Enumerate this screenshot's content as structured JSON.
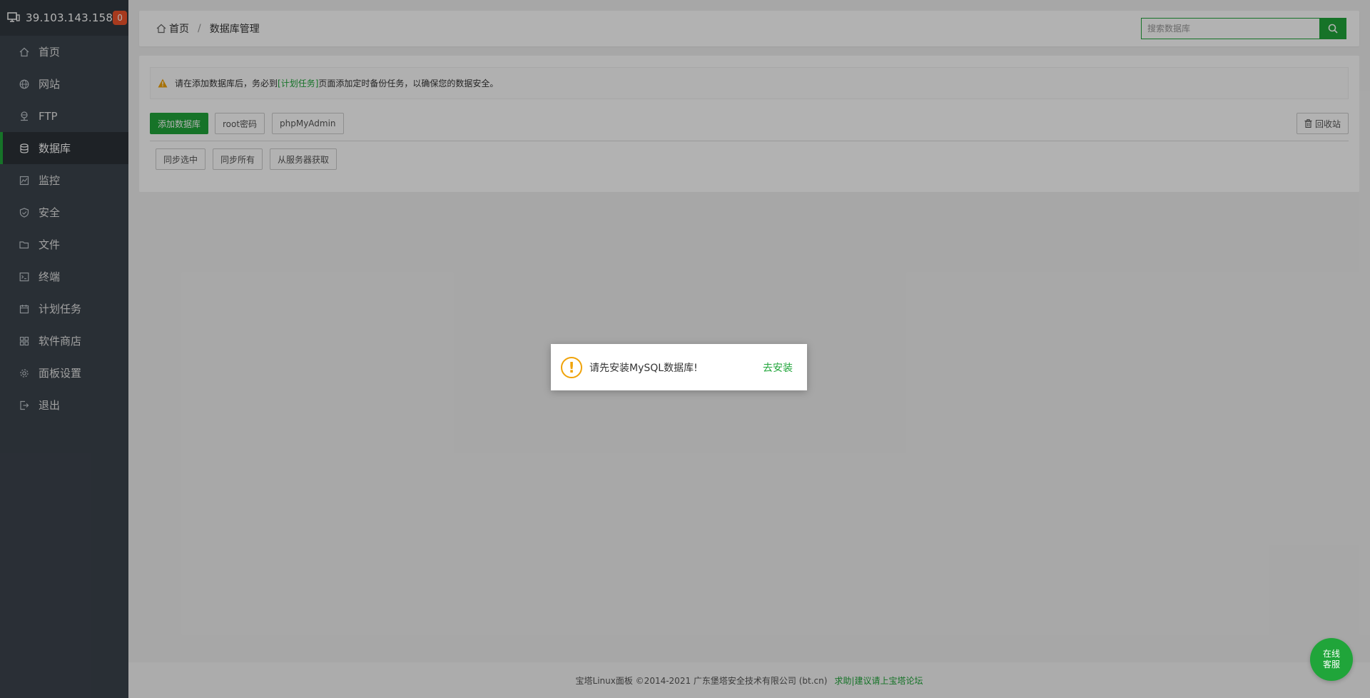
{
  "header": {
    "ip": "39.103.143.158",
    "badge": "0"
  },
  "sidebar": {
    "items": [
      {
        "label": "首页",
        "icon": "home-icon"
      },
      {
        "label": "网站",
        "icon": "globe-icon"
      },
      {
        "label": "FTP",
        "icon": "ftp-icon"
      },
      {
        "label": "数据库",
        "icon": "database-icon",
        "active": true
      },
      {
        "label": "监控",
        "icon": "monitor-icon"
      },
      {
        "label": "安全",
        "icon": "shield-icon"
      },
      {
        "label": "文件",
        "icon": "folder-icon"
      },
      {
        "label": "终端",
        "icon": "terminal-icon"
      },
      {
        "label": "计划任务",
        "icon": "calendar-icon"
      },
      {
        "label": "软件商店",
        "icon": "grid-icon"
      },
      {
        "label": "面板设置",
        "icon": "gear-icon"
      },
      {
        "label": "退出",
        "icon": "logout-icon"
      }
    ]
  },
  "breadcrumb": {
    "home": "首页",
    "separator": "/",
    "current": "数据库管理"
  },
  "search": {
    "placeholder": "搜索数据库"
  },
  "notice": {
    "prefix": "请在添加数据库后，务必到",
    "link": "[计划任务]",
    "suffix": "页面添加定时备份任务，以确保您的数据安全。"
  },
  "toolbar": {
    "add_db": "添加数据库",
    "root_pw": "root密码",
    "phpmyadmin": "phpMyAdmin",
    "recycle": "回收站",
    "sync_selected": "同步选中",
    "sync_all": "同步所有",
    "fetch_server": "从服务器获取"
  },
  "dialog": {
    "message": "请先安装MySQL数据库!",
    "action": "去安装"
  },
  "footer": {
    "copyright": "宝塔Linux面板 ©2014-2021 广东堡塔安全技术有限公司 (bt.cn)",
    "forum_link": "求助|建议请上宝塔论坛"
  },
  "service": {
    "line1": "在线",
    "line2": "客服"
  },
  "colors": {
    "accent": "#20a53a",
    "sidebar_bg": "#3c444d",
    "badge": "#f0542c",
    "warning": "#f0a30a"
  }
}
